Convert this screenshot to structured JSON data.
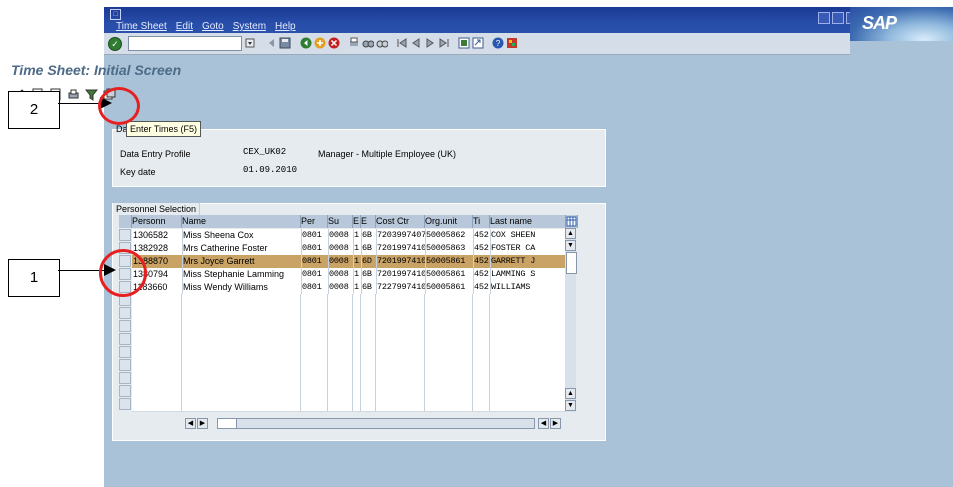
{
  "menu": [
    "Time Sheet",
    "Edit",
    "Goto",
    "System",
    "Help"
  ],
  "logo": "SAP",
  "screen_title": "Time Sheet: Initial Screen",
  "tooltip": "Enter Times  (F5)",
  "data_section": {
    "header_partial": "Da",
    "profile_label": "Data Entry Profile",
    "profile_value": "CEX_UK02",
    "profile_desc": "Manager - Multiple Employee (UK)",
    "keydate_label": "Key date",
    "keydate_value": "01.09.2010"
  },
  "personnel": {
    "header": "Personnel Selection",
    "columns": [
      "Personn",
      "Name",
      "Per",
      "Su",
      "E",
      "E",
      "Cost Ctr",
      "Org.unit",
      "Ti",
      "Last name"
    ],
    "rows": [
      {
        "id": "1306582",
        "name": "Miss Sheena Cox",
        "per": "0801",
        "su": "0008",
        "e1": "1",
        "e2": "6B",
        "cost": "7203997407",
        "org": "50005862",
        "ti": "452",
        "last": "COX SHEEN"
      },
      {
        "id": "1382928",
        "name": "Mrs Catherine Foster",
        "per": "0801",
        "su": "0008",
        "e1": "1",
        "e2": "6B",
        "cost": "7201997410",
        "org": "50005863",
        "ti": "452",
        "last": "FOSTER CA"
      },
      {
        "id": "1388870",
        "name": "Mrs Joyce Garrett",
        "per": "0801",
        "su": "0008",
        "e1": "1",
        "e2": "6D",
        "cost": "7201997410",
        "org": "50005861",
        "ti": "452",
        "last": "GARRETT J"
      },
      {
        "id": "1380794",
        "name": "Miss Stephanie Lamming",
        "per": "0801",
        "su": "0008",
        "e1": "1",
        "e2": "6B",
        "cost": "7201997410",
        "org": "50005861",
        "ti": "452",
        "last": "LAMMING S"
      },
      {
        "id": "1183660",
        "name": "Miss Wendy Williams",
        "per": "0801",
        "su": "0008",
        "e1": "1",
        "e2": "6B",
        "cost": "7227997410",
        "org": "50005861",
        "ti": "452",
        "last": "WILLIAMS"
      }
    ],
    "selected_row": 2,
    "empty_rows": 9
  },
  "callouts": {
    "one": "1",
    "two": "2"
  },
  "colors": {
    "selected_row": "#c9a266",
    "annotation_red": "#e62020",
    "screen_bg": "#a9c2d8"
  }
}
